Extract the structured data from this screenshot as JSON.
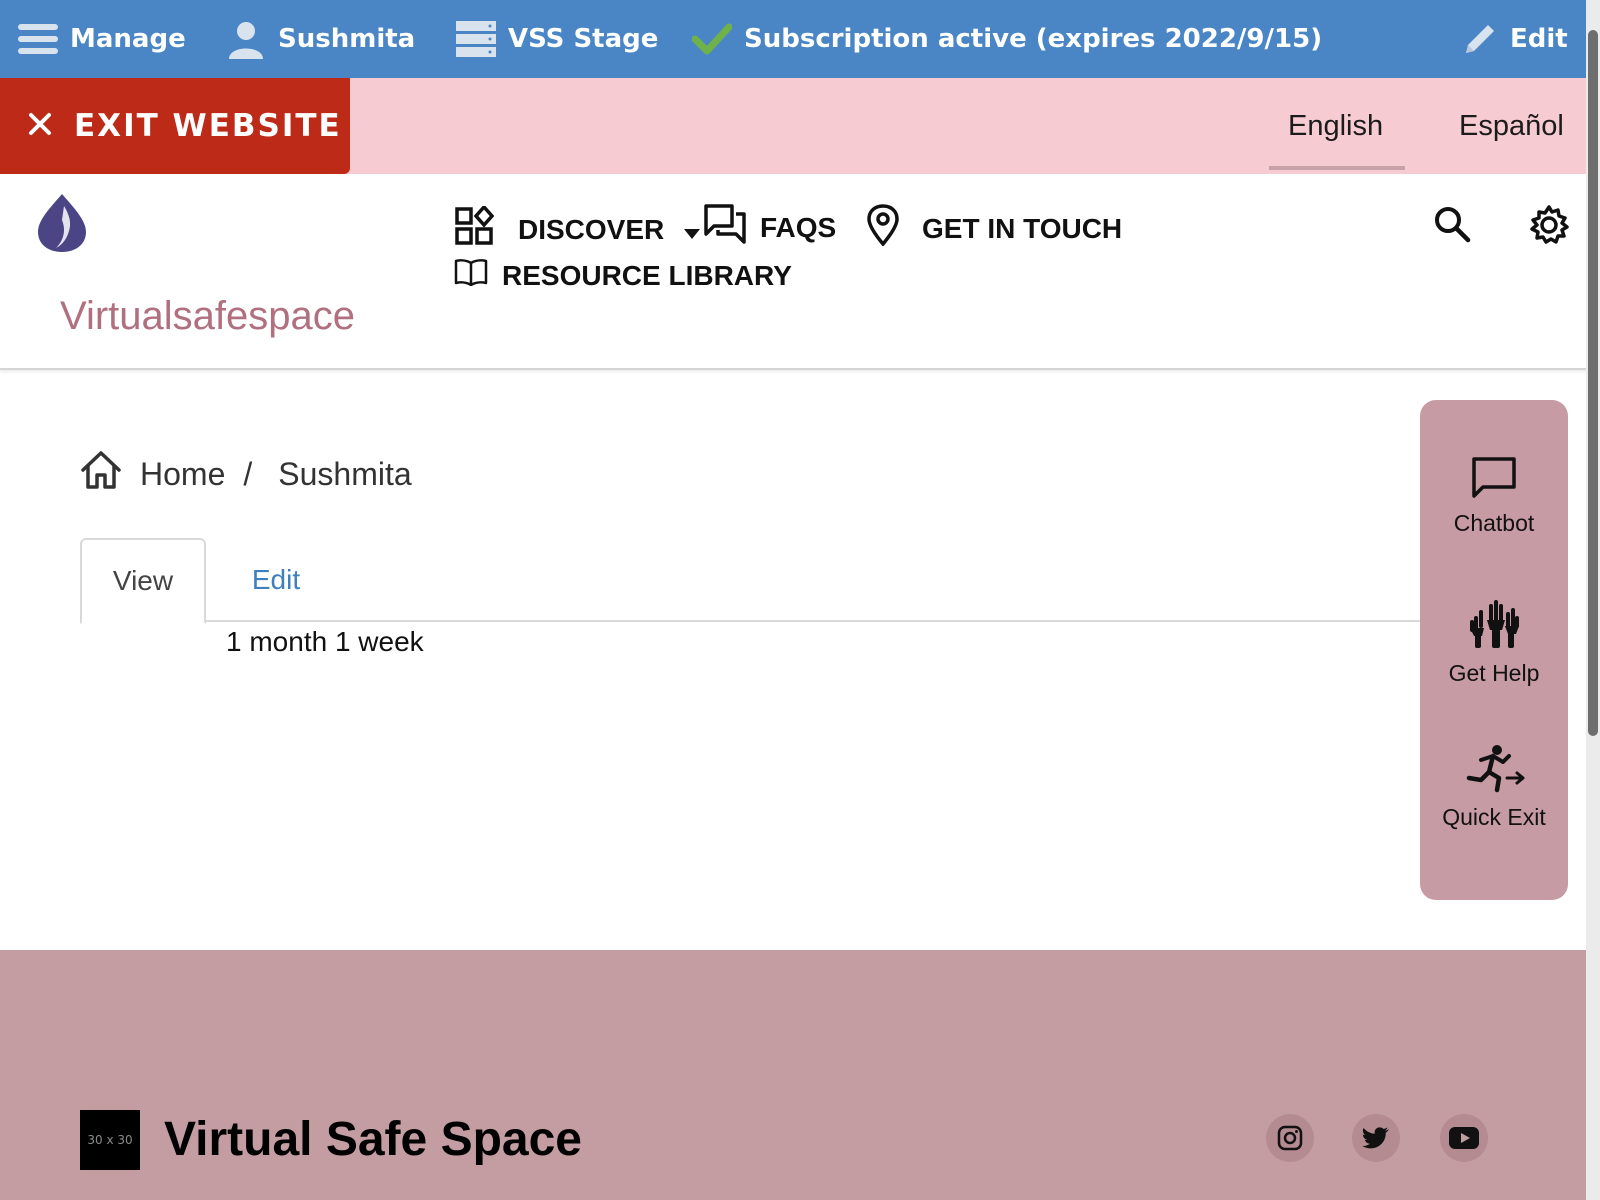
{
  "admin_bar": {
    "manage": "Manage",
    "user": "Sushmita",
    "site": "VSS Stage",
    "subscription": "Subscription active (expires 2022/9/15)",
    "edit": "Edit",
    "colors": {
      "background": "#4a86c6",
      "check": "#6fb24a"
    }
  },
  "lang_bar": {
    "exit": "EXIT WEBSITE",
    "languages": [
      "English",
      "Español"
    ],
    "active_language": "English",
    "colors": {
      "background": "#f6ccd2",
      "exit_button": "#be2a18"
    }
  },
  "header": {
    "site_name": "Virtualsafespace",
    "nav": {
      "discover": "DISCOVER",
      "faqs": "FAQS",
      "get_in_touch": "GET IN TOUCH",
      "resource_library": "RESOURCE LIBRARY"
    },
    "colors": {
      "logo": "#4b4585",
      "site_name": "#b0707f"
    }
  },
  "breadcrumb": {
    "home": "Home",
    "separator": "/",
    "current": "Sushmita"
  },
  "tabs": {
    "view": "View",
    "edit": "Edit",
    "active": "View"
  },
  "content": {
    "duration": "1 month 1 week"
  },
  "side_panel": {
    "chatbot": "Chatbot",
    "get_help": "Get Help",
    "quick_exit": "Quick Exit",
    "colors": {
      "background": "#c79ba3"
    }
  },
  "footer": {
    "logo_placeholder": "30 x 30",
    "title": "Virtual Safe Space",
    "social": [
      "instagram-icon",
      "twitter-icon",
      "youtube-icon"
    ],
    "colors": {
      "background": "#c49da2"
    }
  }
}
